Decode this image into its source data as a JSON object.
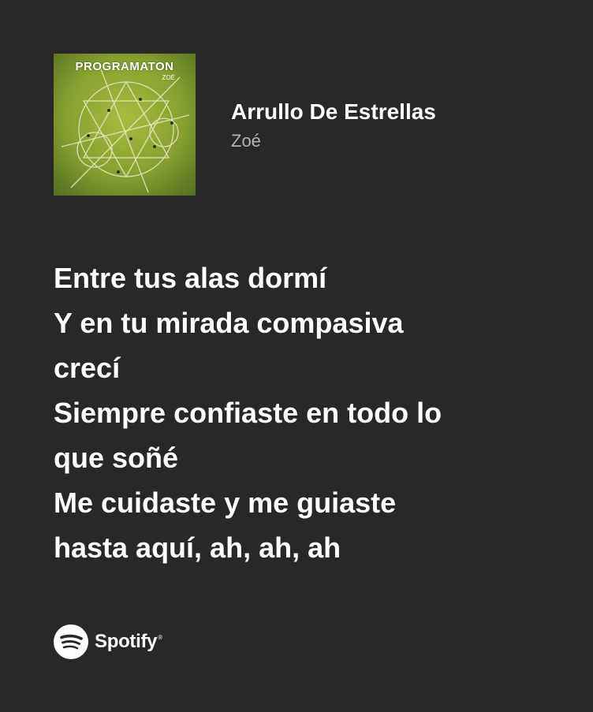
{
  "album": {
    "cover_title": "PROGRAMATON",
    "cover_subtitle": "ZOÉ",
    "colors": {
      "grass_light": "#9cb23a",
      "grass_dark": "#5c7a23",
      "lines": "#e8e6c8"
    }
  },
  "track": {
    "title": "Arrullo De Estrellas",
    "artist": "Zoé"
  },
  "lyrics": {
    "lines": [
      "Entre tus alas dormí",
      "Y en tu mirada compasiva",
      "crecí",
      "Siempre confiaste en todo lo",
      "que soñé",
      "Me cuidaste y me guiaste",
      "hasta aquí, ah, ah, ah"
    ]
  },
  "brand": {
    "name": "Spotify",
    "mark": "®",
    "icon": "spotify-logo-icon"
  },
  "theme": {
    "background": "#282828",
    "text": "#ffffff",
    "secondary_text": "#b3b3b3"
  }
}
